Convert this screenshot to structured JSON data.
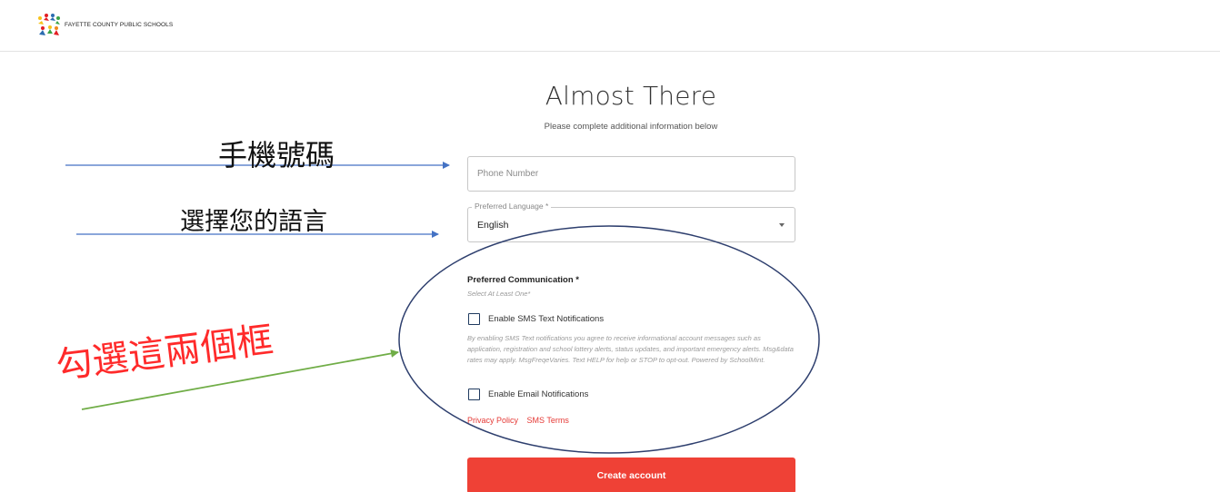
{
  "header": {
    "brand": "FAYETTE COUNTY PUBLIC SCHOOLS"
  },
  "main": {
    "title": "Almost There",
    "subtitle": "Please complete additional information below",
    "phone": {
      "placeholder": "Phone Number",
      "value": ""
    },
    "language": {
      "legend": "Preferred Language *",
      "selected": "English"
    },
    "communication": {
      "label": "Preferred Communication *",
      "hint": "Select At Least One*",
      "sms_label": "Enable SMS Text Notifications",
      "sms_checked": false,
      "disclaimer": "By enabling SMS Text notifications you agree to receive informational account messages such as application, registration and school lottery alerts, status updates, and important emergency alerts. Msg&data rates may apply. MsgFreqeVaries. Text HELP for help or STOP to opt-out. Powered by SchoolMint.",
      "email_label": "Enable Email Notifications",
      "email_checked": false
    },
    "links": {
      "privacy": "Privacy Policy",
      "sms_terms": "SMS Terms"
    },
    "create_button": "Create account"
  },
  "annotations": {
    "phone_note": "手機號碼",
    "language_note": "選擇您的語言",
    "checkbox_note": "勾選這兩個框"
  },
  "colors": {
    "accent": "#ef4136",
    "link": "#e53935",
    "checkbox_border": "#1f3a5f",
    "arrow_blue": "#4472c4",
    "arrow_green": "#70ad47",
    "ellipse": "#2e3f6e",
    "annotation_red": "#ff2a2a"
  }
}
